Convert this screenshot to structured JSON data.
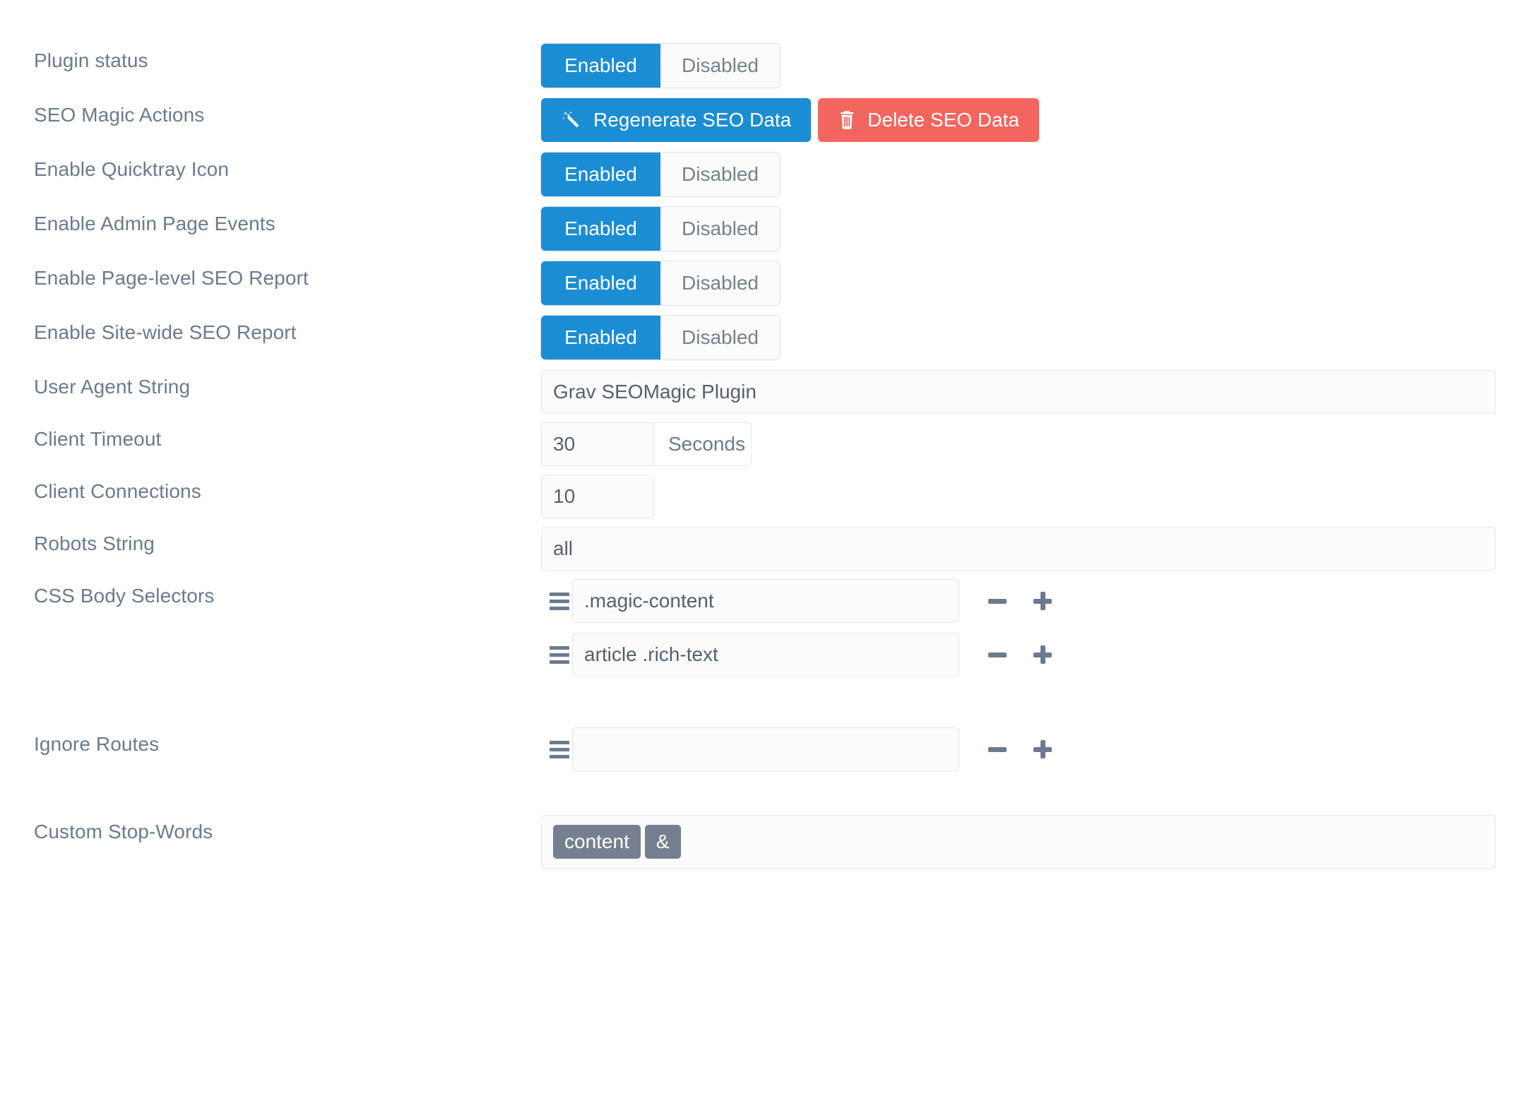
{
  "theme": {
    "accent_blue": "#1b8dd4",
    "danger_red": "#f3655f",
    "label_text": "#697b8e",
    "tag_bg": "#74808f",
    "input_bg": "#fbfbfc",
    "input_border": "#e4e7ea"
  },
  "toggle": {
    "enabled_label": "Enabled",
    "disabled_label": "Disabled"
  },
  "rows": {
    "plugin_status": {
      "label": "Plugin status",
      "value": "Enabled"
    },
    "seo_magic_actions": {
      "label": "SEO Magic Actions",
      "regenerate_label": "Regenerate SEO Data",
      "delete_label": "Delete SEO Data",
      "regenerate_icon": "magic-wand-icon",
      "delete_icon": "trash-icon"
    },
    "enable_quicktray_icon": {
      "label": "Enable Quicktray Icon",
      "value": "Enabled"
    },
    "enable_admin_page_events": {
      "label": "Enable Admin Page Events",
      "value": "Enabled"
    },
    "enable_page_level_seo_report": {
      "label": "Enable Page-level SEO Report",
      "value": "Enabled"
    },
    "enable_site_wide_seo_report": {
      "label": "Enable Site-wide SEO Report",
      "value": "Enabled"
    },
    "user_agent_string": {
      "label": "User Agent String",
      "value": "Grav SEOMagic Plugin",
      "placeholder": ""
    },
    "client_timeout": {
      "label": "Client Timeout",
      "value": "30",
      "suffix": "Seconds"
    },
    "client_connections": {
      "label": "Client Connections",
      "value": "10"
    },
    "robots_string": {
      "label": "Robots String",
      "value": "all",
      "placeholder": ""
    },
    "css_body_selectors": {
      "label": "CSS Body Selectors",
      "items": [
        {
          "value": ".magic-content"
        },
        {
          "value": "article .rich-text"
        }
      ]
    },
    "ignore_routes": {
      "label": "Ignore Routes",
      "items": [
        {
          "value": ""
        }
      ]
    },
    "custom_stop_words": {
      "label": "Custom Stop-Words",
      "tags": [
        "content",
        "&"
      ]
    }
  }
}
